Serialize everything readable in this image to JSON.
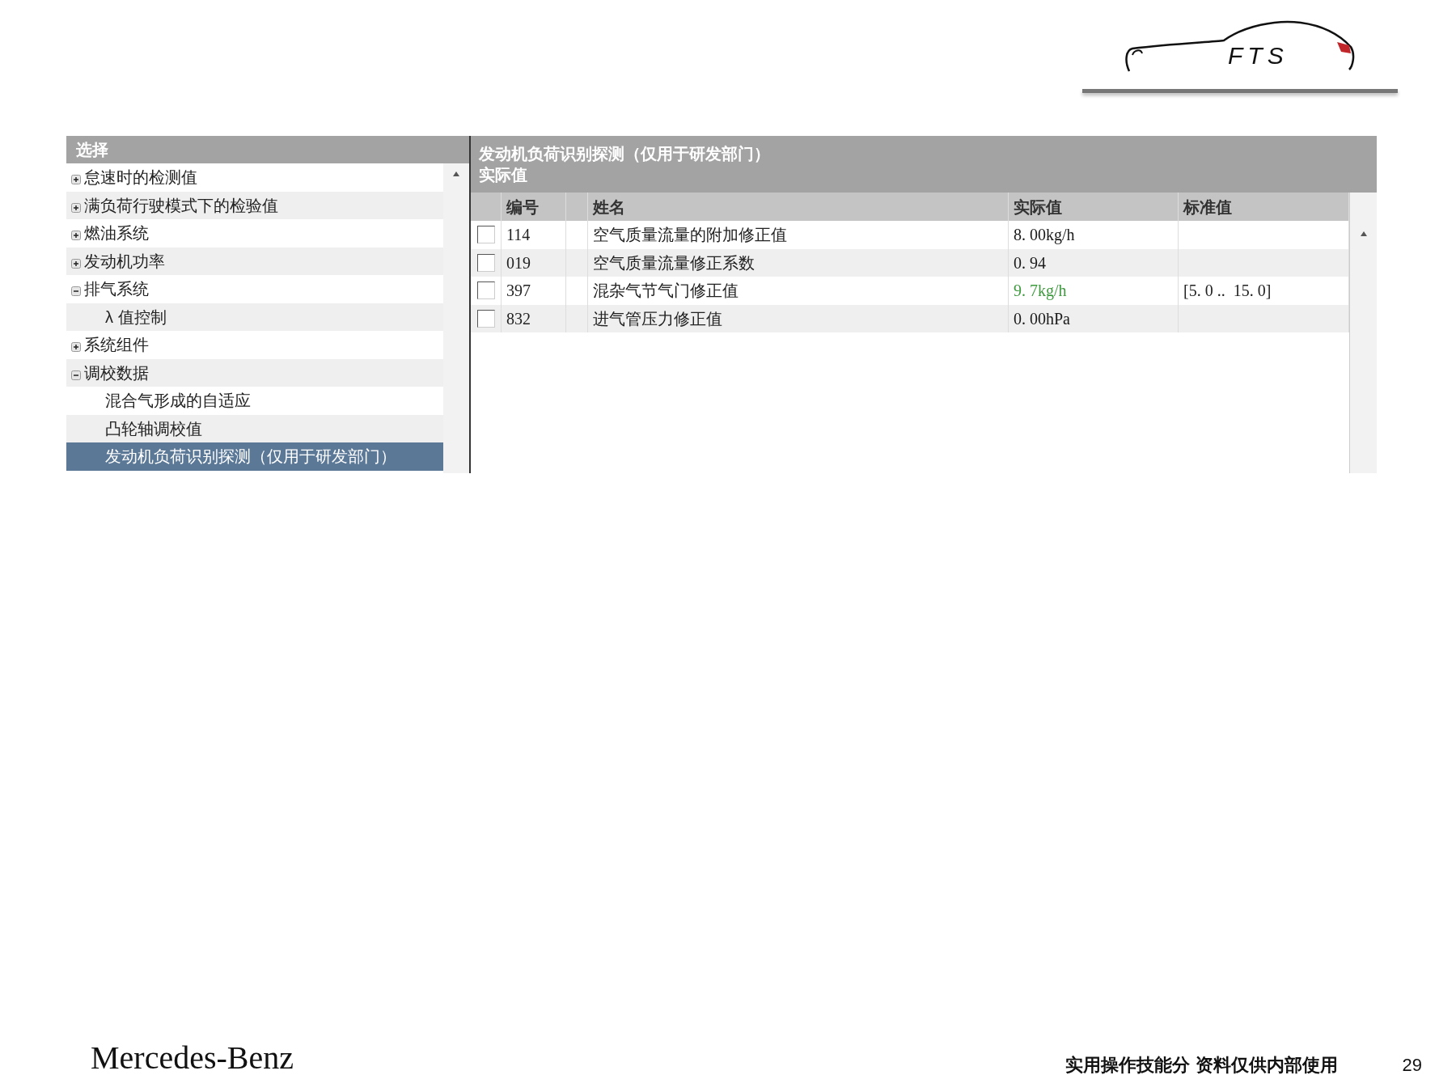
{
  "logo": {
    "text": "FTS"
  },
  "tree_panel": {
    "title": "选择",
    "items": [
      {
        "label": "怠速时的检测值",
        "expanded": false,
        "selected": false
      },
      {
        "label": "满负荷行驶模式下的检验值",
        "expanded": false,
        "selected": false
      },
      {
        "label": "燃油系统",
        "expanded": false,
        "selected": false
      },
      {
        "label": "发动机功率",
        "expanded": false,
        "selected": false
      },
      {
        "label": "排气系统",
        "expanded": true,
        "selected": false,
        "children": [
          {
            "label": "λ 值控制",
            "selected": false
          }
        ]
      },
      {
        "label": "系统组件",
        "expanded": false,
        "selected": false
      },
      {
        "label": "调校数据",
        "expanded": true,
        "selected": false,
        "children": [
          {
            "label": "混合气形成的自适应",
            "selected": false
          },
          {
            "label": "凸轮轴调校值",
            "selected": false
          },
          {
            "label": "发动机负荷识别探测（仅用于研发部门）",
            "selected": true
          }
        ]
      }
    ]
  },
  "values_panel": {
    "title": "发动机负荷识别探测（仅用于研发部门）",
    "subtitle": "实际值",
    "table": {
      "columns": [
        "编号",
        "姓名",
        "实际值",
        "标准值"
      ],
      "rows": [
        {
          "checked": false,
          "number": "114",
          "name": "空气质量流量的附加修正值",
          "actual": "8. 00kg/h",
          "color": "#1a1a1a"
        },
        {
          "checked": false,
          "number": "019",
          "name": "空气质量流量修正系数",
          "actual": "0. 94",
          "color": "#1a1a1a"
        },
        {
          "checked": false,
          "number": "397",
          "name": "混杂气节气门修正值",
          "actual": "9. 7kg/h",
          "color": "#3f9a3f",
          "standard": "[5. 0 ..  15. 0]"
        },
        {
          "checked": false,
          "number": "832",
          "name": "进气管压力修正值",
          "actual": "0. 00hPa",
          "color": "#1a1a1a"
        }
      ]
    }
  },
  "footer": {
    "brand": "Mercedes-Benz",
    "note": "实用操作技能分 资料仅供内部使用",
    "page_number": "29"
  }
}
